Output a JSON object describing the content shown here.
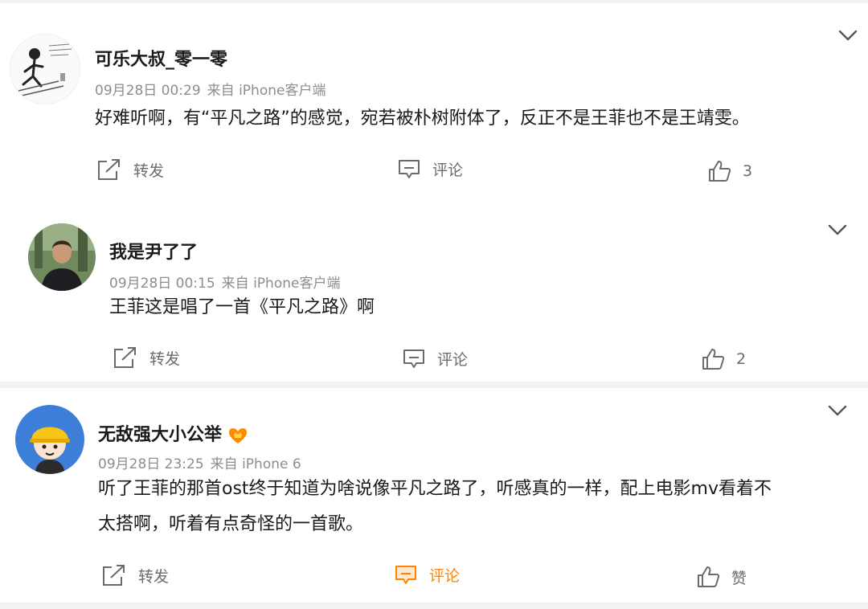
{
  "comments": [
    {
      "name": "可乐大叔_零一零",
      "date": "09月28日 00:29",
      "source": "来自 iPhone客户端",
      "lines": [
        "好难听啊，有“平凡之路”的感觉，宛若被朴树附体了，反正不是王菲也不是王靖雯。"
      ],
      "repost_label": "转发",
      "comment_label": "评论",
      "like_count": "3"
    },
    {
      "name": "我是尹了了",
      "date": "09月28日 00:15",
      "source": "来自 iPhone客户端",
      "lines": [
        "王菲这是唱了一首《平凡之路》啊"
      ],
      "repost_label": "转发",
      "comment_label": "评论",
      "like_count": "2"
    },
    {
      "name": "无敌强大小公举",
      "date": "09月28日 23:25",
      "source": "来自 iPhone 6",
      "lines": [
        "听了王菲的那首ost终于知道为啥说像平凡之路了，听感真的一样，配上电影mv看着不",
        "太搭啊，听着有点奇怪的一首歌。"
      ],
      "repost_label": "转发",
      "comment_label": "评论",
      "like_label": "赞"
    }
  ],
  "colors": {
    "accent": "#ff8200",
    "meta": "#8d8d8d",
    "separator": "#f2f2f2"
  }
}
